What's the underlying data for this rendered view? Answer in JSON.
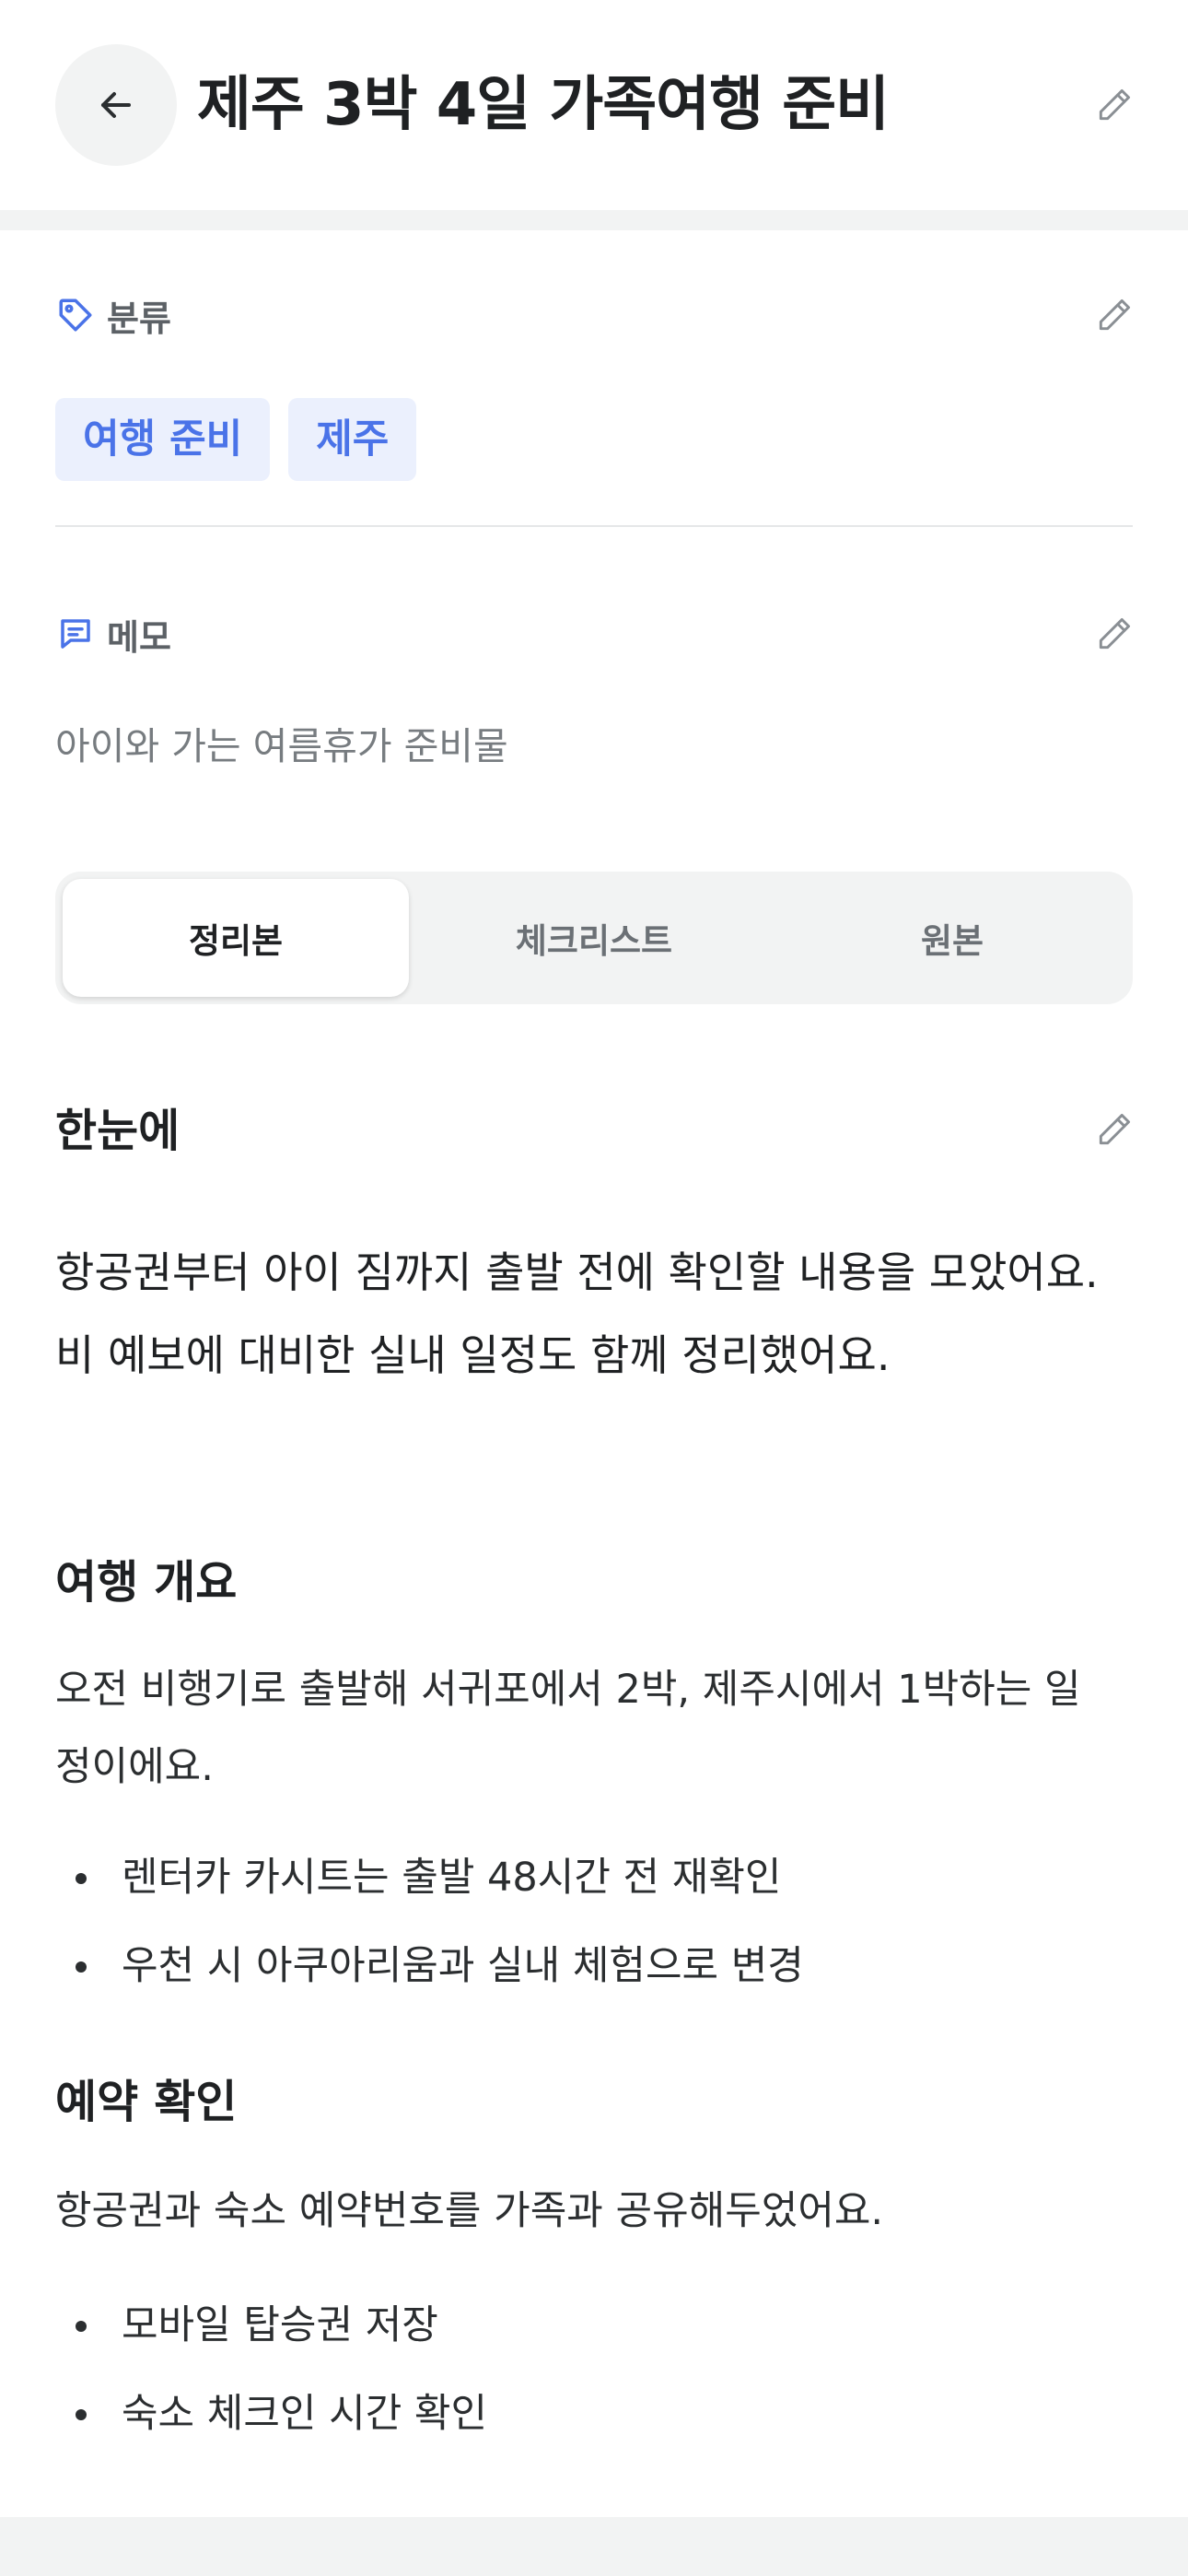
{
  "header": {
    "title": "제주 3박 4일 가족여행 준비",
    "back_icon": "arrow-left-icon",
    "edit_icon": "pencil-icon"
  },
  "category": {
    "label": "분류",
    "icon": "tag-icon",
    "tags": [
      "여행 준비",
      "제주"
    ]
  },
  "memo": {
    "label": "메모",
    "icon": "message-icon",
    "text": "아이와 가는 여름휴가 준비물"
  },
  "tabs": [
    {
      "label": "정리본",
      "active": true
    },
    {
      "label": "체크리스트",
      "active": false
    },
    {
      "label": "원본",
      "active": false
    }
  ],
  "summary": {
    "heading": "한눈에",
    "lines": [
      "항공권부터 아이 짐까지 출발 전에 확인할 내용을 모았어요.",
      "비 예보에 대비한 실내 일정도 함께 정리했어요."
    ]
  },
  "sections": [
    {
      "heading": "여행 개요",
      "lines": [
        "오전 비행기로 출발해 서귀포에서 2박, 제주시에서 1박하는 일",
        "정이에요."
      ],
      "bullets": [
        "렌터카 카시트는 출발 48시간 전 재확인",
        "우천 시 아쿠아리움과 실내 체험으로 변경"
      ]
    },
    {
      "heading": "예약 확인",
      "lines": [
        "항공권과 숙소 예약번호를 가족과 공유해두었어요."
      ],
      "bullets": [
        "모바일 탑승권 저장",
        "숙소 체크인 시간 확인"
      ]
    }
  ],
  "colors": {
    "accent": "#4a73e8",
    "tag_bg": "#ebf0fd",
    "gray_bg": "#f2f3f3"
  }
}
